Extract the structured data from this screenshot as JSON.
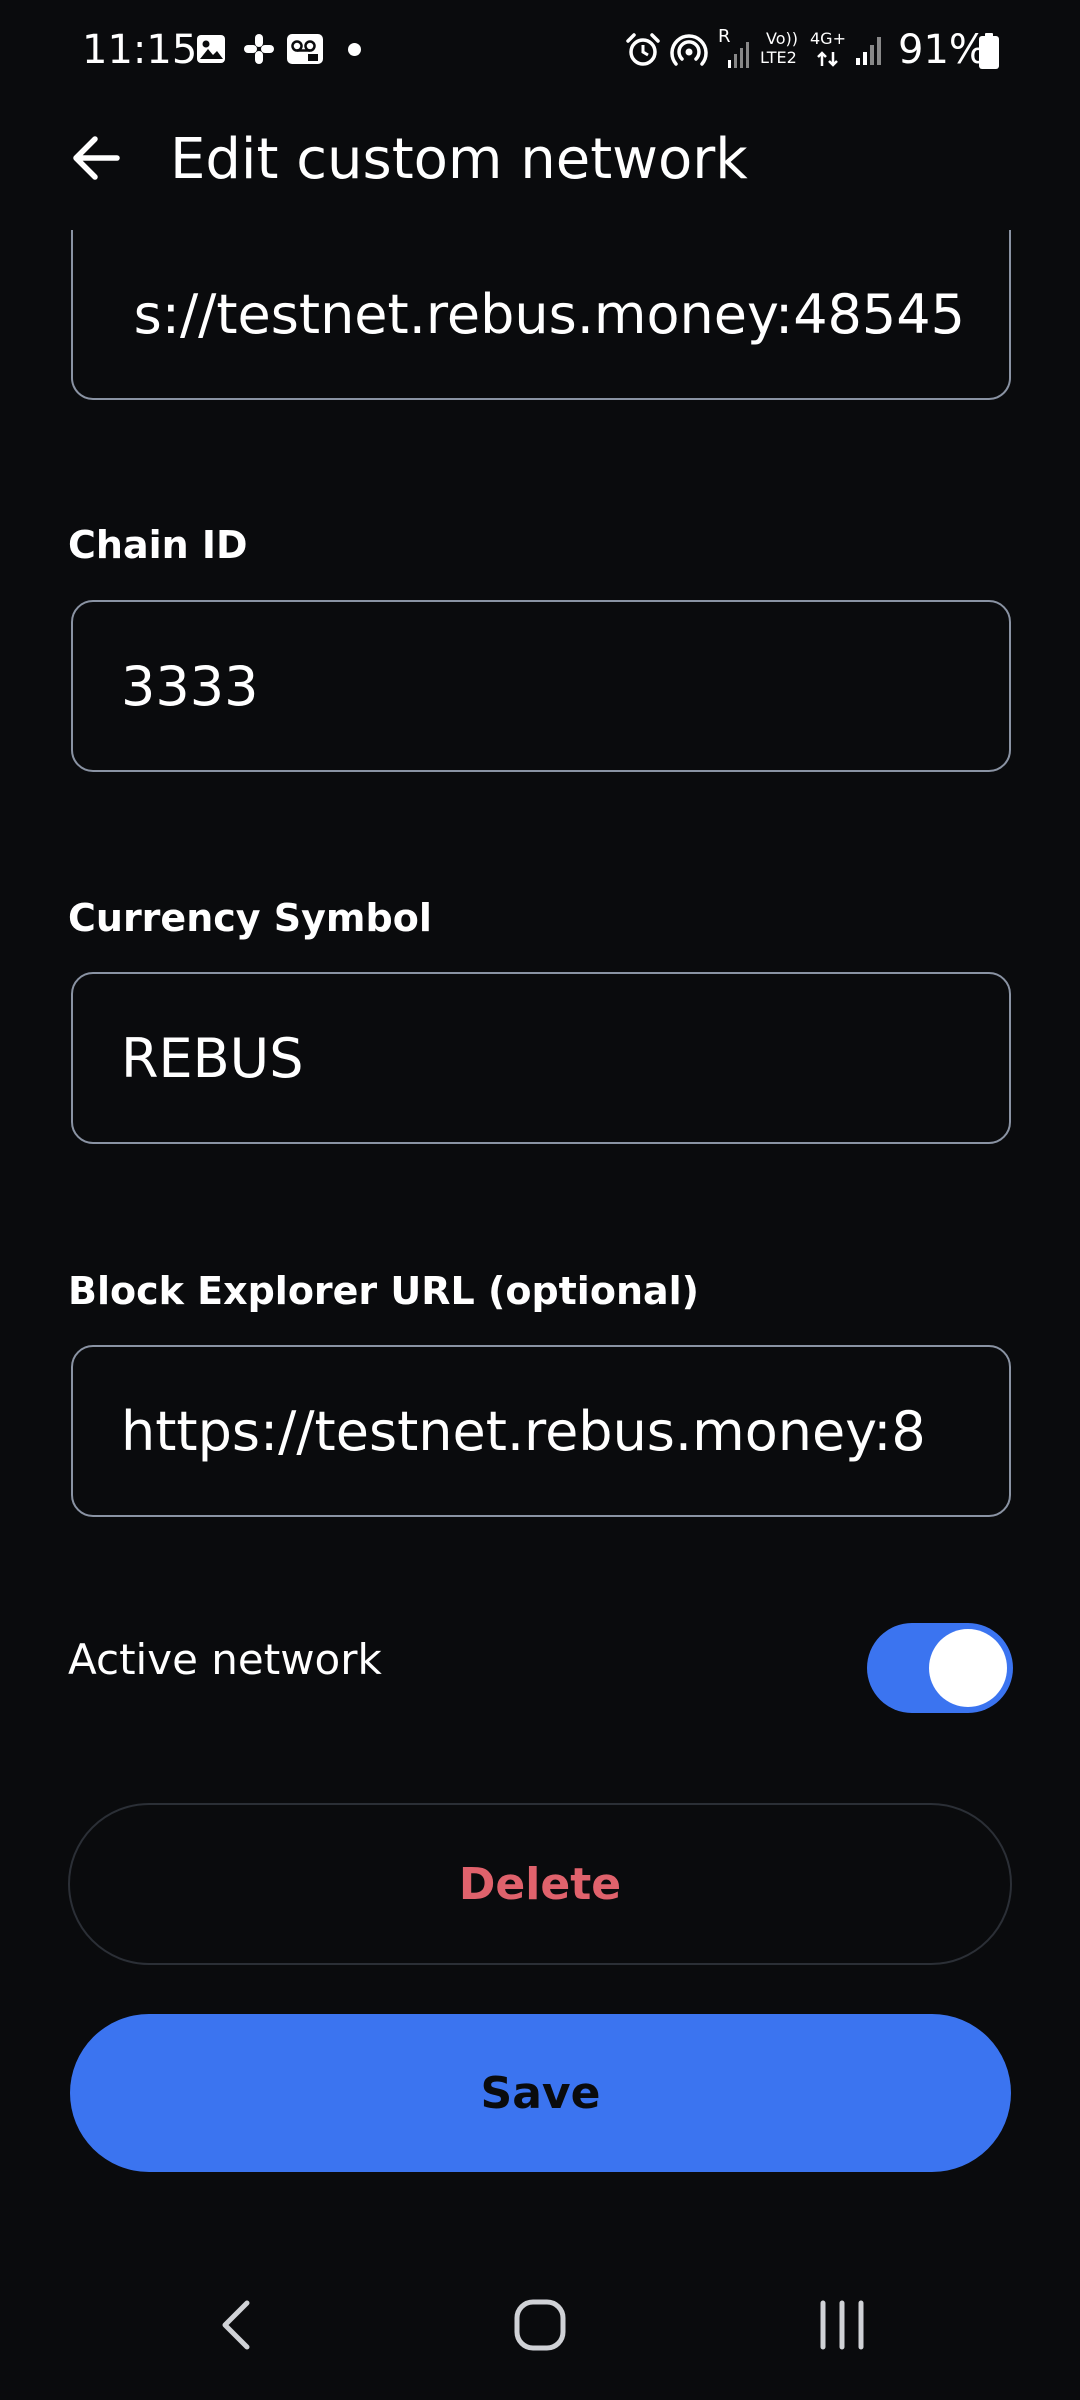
{
  "status_bar": {
    "time": "11:15",
    "battery_text": "91%",
    "icons": [
      "gallery-icon",
      "slack-icon",
      "voicemail-icon",
      "dot-icon",
      "alarm-icon",
      "hotspot-icon",
      "signal-r-icon",
      "volte-icon",
      "4g-icon",
      "signal-icon",
      "battery-icon"
    ],
    "volte_text_top": "Vo))",
    "volte_text_bottom": "LTE2",
    "network_type": "4G+",
    "roaming_text": "R"
  },
  "header": {
    "title": "Edit custom network",
    "back_icon": "arrow-left-icon"
  },
  "form": {
    "rpc_url": {
      "value": "s://testnet.rebus.money:48545"
    },
    "chain_id": {
      "label": "Chain ID",
      "value": "3333"
    },
    "currency_symbol": {
      "label": "Currency Symbol",
      "value": "REBUS"
    },
    "block_explorer": {
      "label": "Block Explorer URL (optional)",
      "value": "https://testnet.rebus.money:8"
    }
  },
  "active_network": {
    "label": "Active network",
    "enabled": true
  },
  "buttons": {
    "delete_label": "Delete",
    "save_label": "Save"
  },
  "colors": {
    "background": "#0a0b0d",
    "accent": "#3b74f0",
    "danger": "#e0626c",
    "field_border": "#8a93a3"
  },
  "nav_bar": {
    "icons": [
      "nav-back-icon",
      "nav-home-icon",
      "nav-recents-icon"
    ]
  }
}
